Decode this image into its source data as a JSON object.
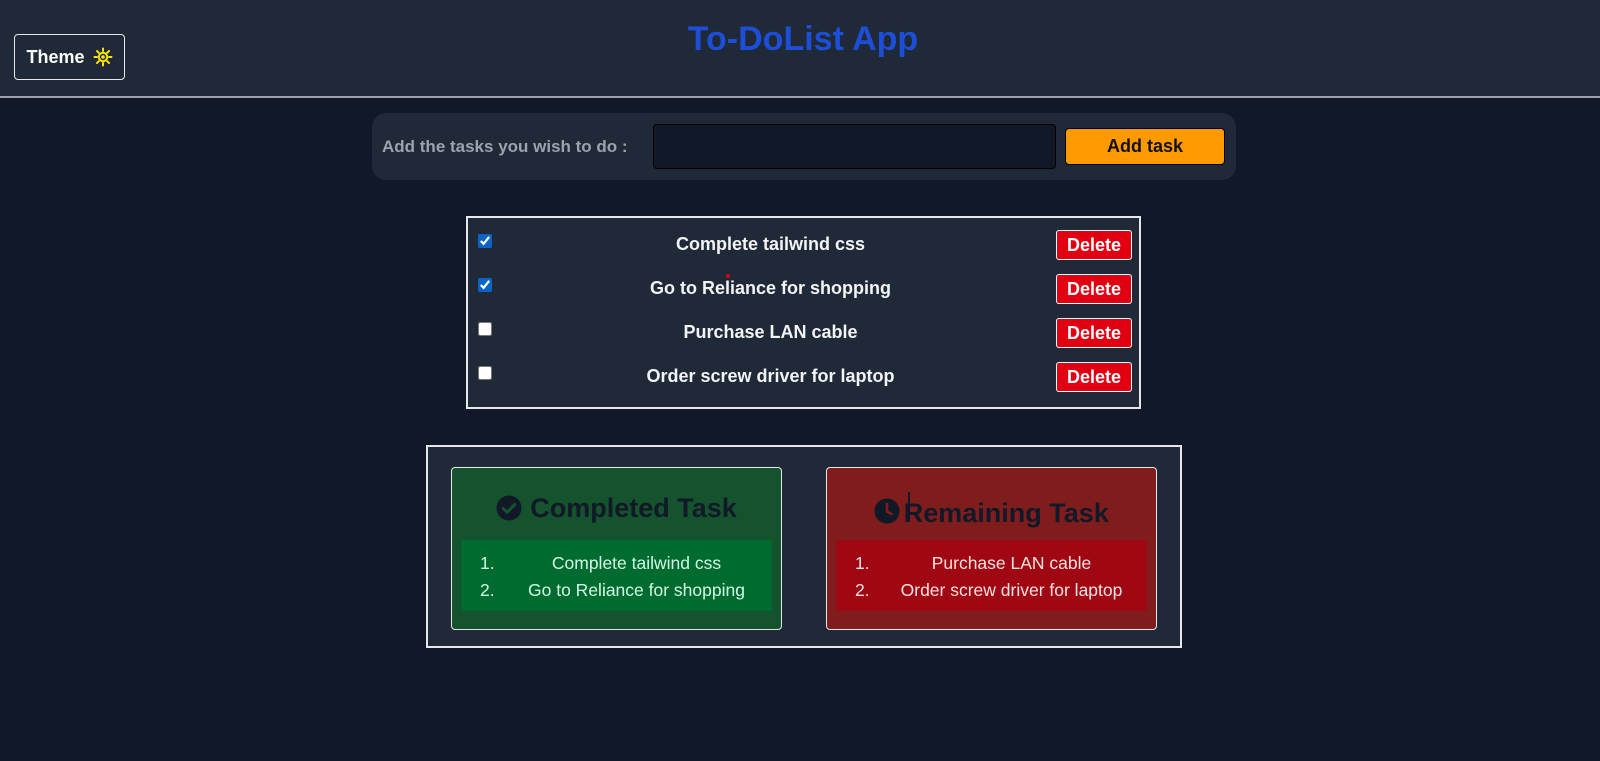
{
  "header": {
    "title": "To-DoList App",
    "theme_label": "Theme"
  },
  "add_task": {
    "label": "Add the tasks you wish to do :",
    "input_value": "",
    "input_placeholder": "",
    "button_label": "Add task"
  },
  "tasks": [
    {
      "text": "Complete tailwind css",
      "checked": true,
      "delete_label": "Delete"
    },
    {
      "text": "Go to Reliance for shopping",
      "checked": true,
      "delete_label": "Delete"
    },
    {
      "text": "Purchase LAN cable",
      "checked": false,
      "delete_label": "Delete"
    },
    {
      "text": "Order screw driver for laptop",
      "checked": false,
      "delete_label": "Delete"
    }
  ],
  "summary": {
    "completed": {
      "title": "Completed Task",
      "icon": "check-circle-icon",
      "items": [
        {
          "num": "1.",
          "text": "Complete tailwind css"
        },
        {
          "num": "2.",
          "text": "Go to Reliance for shopping"
        }
      ]
    },
    "remaining": {
      "title": "Remaining Task",
      "icon": "clock-icon",
      "items": [
        {
          "num": "1.",
          "text": "Purchase LAN cable"
        },
        {
          "num": "2.",
          "text": "Order screw driver for laptop"
        }
      ]
    }
  },
  "colors": {
    "background": "#111827",
    "panel": "#1f2937",
    "title_blue": "#1d4ed8",
    "add_button": "#ff9900",
    "delete_button": "#e00012",
    "completed_card": "#14532d",
    "remaining_card": "#7f1d1d"
  }
}
